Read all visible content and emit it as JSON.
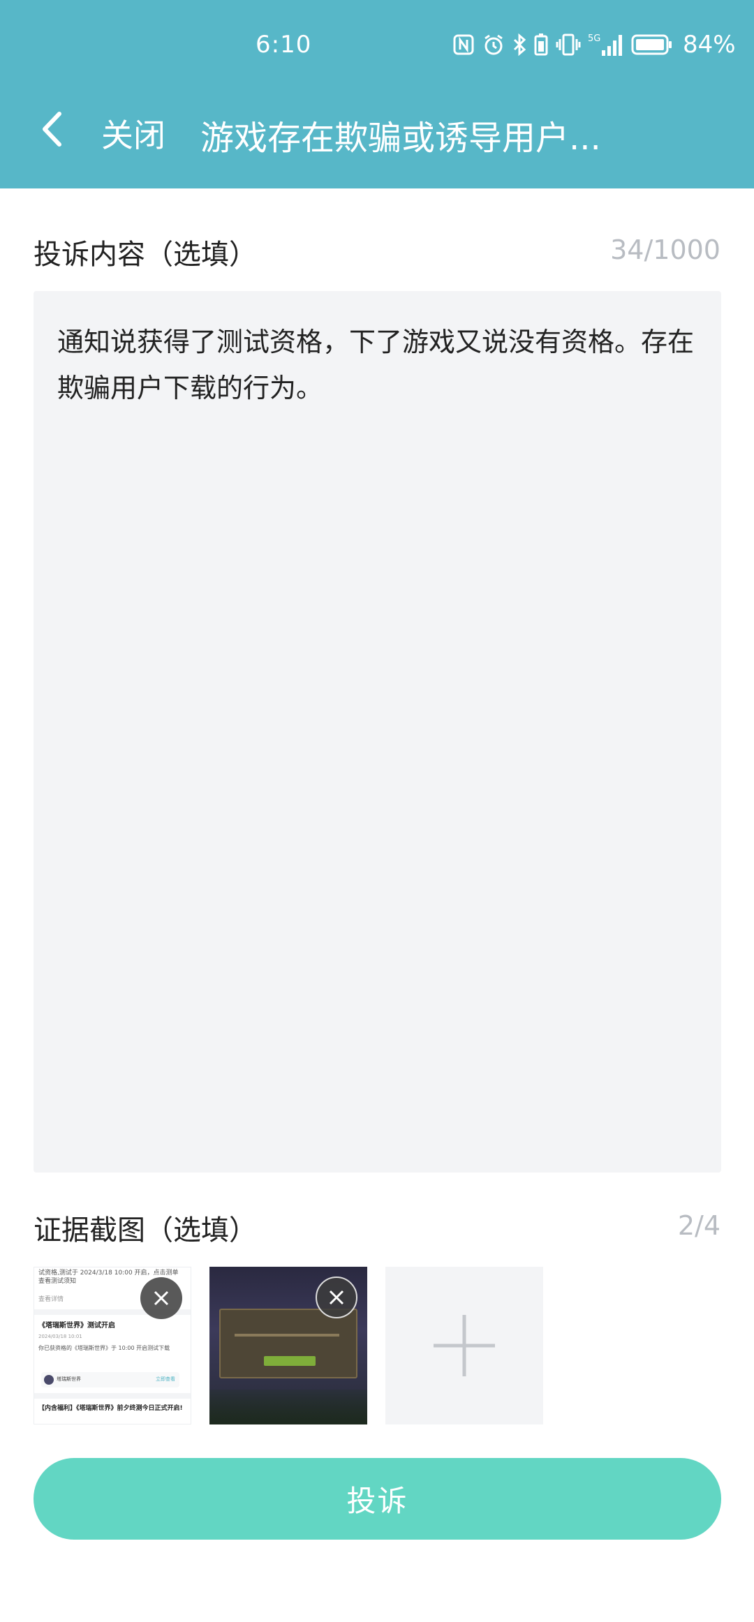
{
  "status_bar": {
    "time": "6:10",
    "battery_percent": "84%",
    "network": "5G",
    "icons": [
      "nfc-icon",
      "alarm-icon",
      "bluetooth-icon",
      "battery-saver-icon",
      "vibrate-icon",
      "signal-icon",
      "battery-icon"
    ]
  },
  "nav": {
    "back_icon": "chevron-left-icon",
    "close_label": "关闭",
    "title": "游戏存在欺骗或诱导用户..."
  },
  "complaint": {
    "label": "投诉内容（选填）",
    "counter": "34/1000",
    "text": "通知说获得了测试资格，下了游戏又说没有资格。存在欺骗用户下载的行为。"
  },
  "evidence": {
    "label": "证据截图（选填）",
    "counter": "2/4",
    "add_icon": "plus-icon",
    "remove_icon": "close-icon",
    "thumb1": {
      "line1": "试资格,测试于 2024/3/18 10:00 开启，点击测单",
      "line2": "查看测试须知",
      "line3": "查看详情",
      "card_title": "《塔瑞斯世界》测试开启",
      "card_date": "2024/03/18 10:01",
      "card_body": "你已获资格的《塔瑞斯世界》于 10:00 开启测试下载",
      "card_game": "塔瑞斯世界",
      "card_action": "立即查看",
      "footer": "【内含福利】《塔瑞斯世界》前夕终测今日正式开启!"
    }
  },
  "submit_label": "投诉",
  "colors": {
    "header": "#57b7c8",
    "submit": "#62d6c3",
    "input_bg": "#f3f4f6",
    "muted": "#b8bcc2"
  }
}
